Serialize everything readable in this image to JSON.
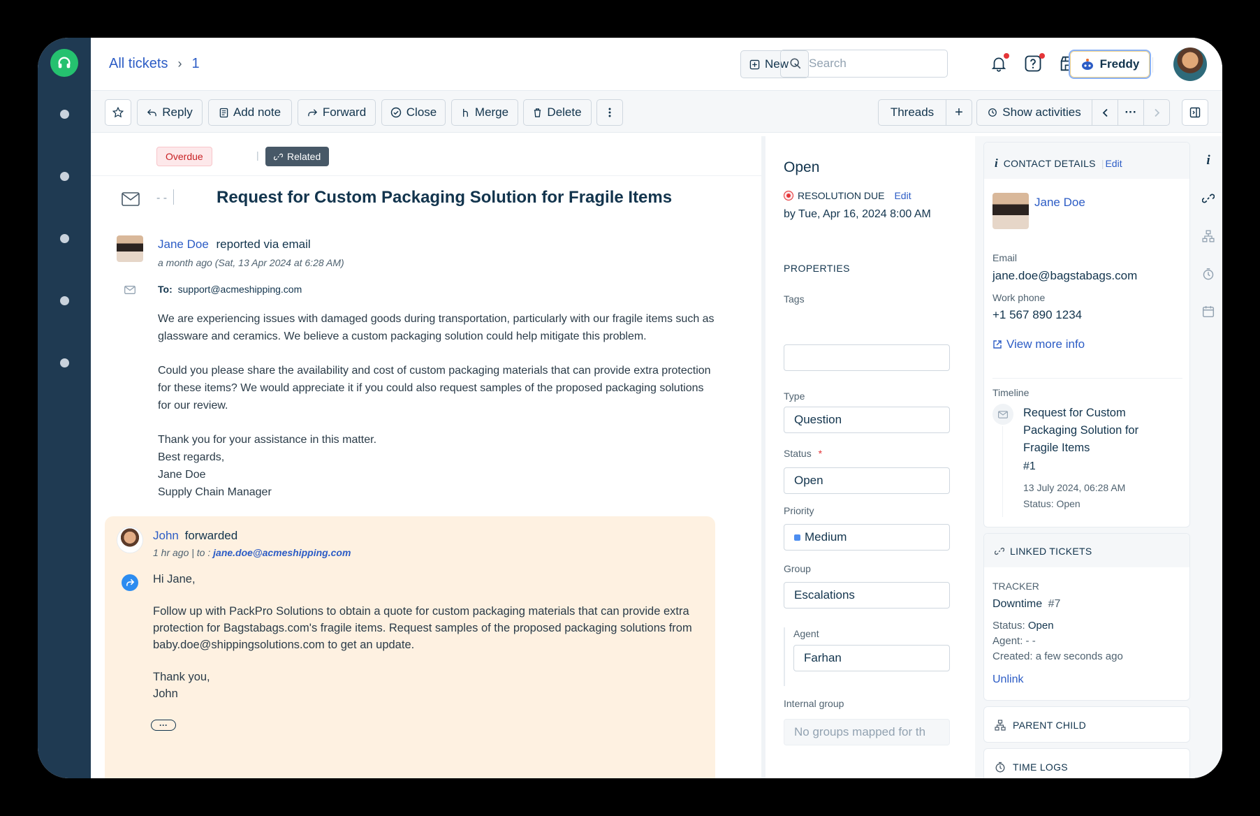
{
  "header": {
    "breadcrumb_root": "All tickets",
    "breadcrumb_sep": "›",
    "ticket_number": "1",
    "new_label": "New",
    "search_placeholder": "Search",
    "freddy_label": "Freddy"
  },
  "toolbar": {
    "reply": "Reply",
    "add_note": "Add note",
    "forward": "Forward",
    "close": "Close",
    "merge": "Merge",
    "delete": "Delete",
    "threads": "Threads",
    "plus": "+",
    "show_activities": "Show activities",
    "more": "···"
  },
  "ticket": {
    "badge_overdue": "Overdue",
    "badge_divider": "|",
    "badge_related": "Related",
    "subject_prefix": "- -",
    "subject": "Request for Custom Packaging Solution for Fragile Items",
    "requester": "Jane Doe",
    "reported_via": "reported via email",
    "time": "a month ago (Sat, 13 Apr 2024 at 6:28 AM)",
    "to_label": "To:",
    "to_value": "support@acmeshipping.com",
    "para1": "We are experiencing issues with damaged goods during transportation, particularly with our fragile items such as glassware and ceramics. We believe a custom packaging solution could help mitigate this problem.",
    "para2": "Could you please share the availability and cost of custom packaging materials that can provide extra protection for these items? We would appreciate it if you could also request samples of the proposed packaging solutions for our review.",
    "sig1": "Thank you for your assistance in this matter.",
    "sig2": "Best regards,",
    "sig3": "Jane Doe",
    "sig4": "Supply Chain Manager"
  },
  "forward": {
    "agent": "John",
    "action": "forwarded",
    "time": "1 hr ago | to : ",
    "to": "jane.doe@acmeshipping.com",
    "greeting": "Hi Jane,",
    "body": "Follow up with PackPro Solutions to obtain a quote for custom packaging materials that can provide extra protection for Bagstabags.com's fragile items. Request samples of the proposed packaging solutions from baby.doe@shippingsolutions.com to get an update.",
    "thanks": "Thank you,",
    "sign": "John",
    "expand": "···"
  },
  "properties": {
    "status_heading": "Open",
    "resolution_label": "RESOLUTION DUE",
    "resolution_edit": "Edit",
    "resolution_due": "by Tue, Apr 16, 2024 8:00 AM",
    "section": "PROPERTIES",
    "tags_label": "Tags",
    "tags_value": "",
    "type_label": "Type",
    "type_value": "Question",
    "status_label": "Status",
    "required": "*",
    "status_value": "Open",
    "priority_label": "Priority",
    "priority_value": "Medium",
    "group_label": "Group",
    "group_value": "Escalations",
    "agent_label": "Agent",
    "agent_value": "Farhan",
    "internal_group_label": "Internal group",
    "internal_group_placeholder": "No groups mapped for th"
  },
  "contact": {
    "heading": "CONTACT DETAILS",
    "edit": "Edit",
    "name": "Jane Doe",
    "email_label": "Email",
    "email": "jane.doe@bagstabags.com",
    "phone_label": "Work phone",
    "phone": "+1 567 890 1234",
    "view_more": "View more info",
    "timeline_label": "Timeline",
    "timeline_title": "Request for Custom Packaging Solution for Fragile Items",
    "timeline_id": "#1",
    "timeline_date": "13 July 2024, 06:28 AM",
    "timeline_status": "Status: Open"
  },
  "linked": {
    "heading": "LINKED TICKETS",
    "tracker_label": "TRACKER",
    "tracker_name": "Downtime",
    "tracker_id": "#7",
    "status_label": "Status:",
    "status_value": "Open",
    "agent_label": "Agent:",
    "agent_value": "- -",
    "created_label": "Created:",
    "created_value": "a few seconds ago",
    "unlink": "Unlink"
  },
  "parent_child": {
    "heading": "PARENT CHILD"
  },
  "time_logs": {
    "heading": "TIME LOGS"
  },
  "colors": {
    "link": "#2c5cc5",
    "sidebar": "#1f3a52",
    "accent_green": "#25c16f",
    "forward_bg": "#fef1e1",
    "overdue_bg": "#fde8ea",
    "overdue_text": "#c82124",
    "priority_medium": "#4d8ef0"
  }
}
